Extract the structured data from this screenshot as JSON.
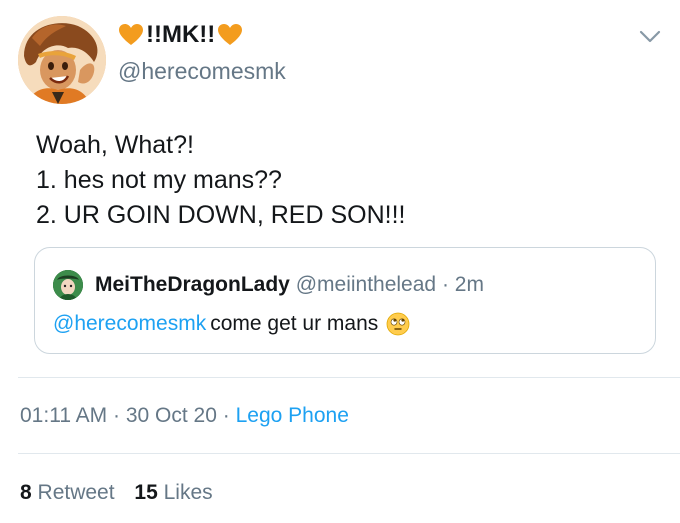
{
  "author": {
    "display_name": "!!MK!!",
    "handle": "@herecomesmk"
  },
  "tweet_text": [
    "Woah, What?!",
    "1. hes not my mans??",
    "2. UR GOIN DOWN, RED SON!!!"
  ],
  "quoted": {
    "display_name": "MeiTheDragonLady",
    "handle": "@meiinthelead",
    "separator": "·",
    "time": "2m",
    "mention": "@herecomesmk",
    "text": "come get ur mans"
  },
  "meta": {
    "time": "01:11 AM",
    "sep1": "·",
    "date": "30 Oct 20",
    "sep2": "·",
    "source": "Lego Phone"
  },
  "stats": {
    "retweets_count": "8",
    "retweets_label": "Retweet",
    "likes_count": "15",
    "likes_label": "Likes"
  },
  "colors": {
    "link": "#1da1f2",
    "secondary_text": "#657786",
    "border": "#ccd6dd",
    "heart": "#f39c1e"
  },
  "icons": {
    "heart": "orange-heart-icon",
    "chevron": "chevron-down-icon",
    "emoji": "face-with-rolling-eyes-icon"
  }
}
